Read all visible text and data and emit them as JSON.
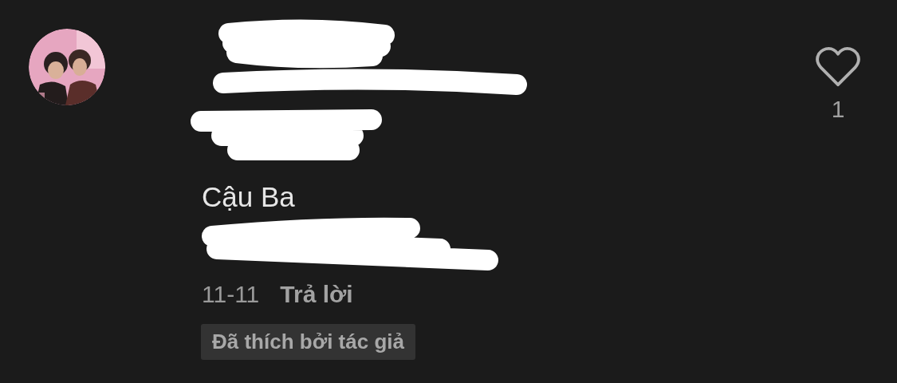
{
  "comment": {
    "lines": [
      {
        "kind": "redaction"
      },
      {
        "kind": "redaction"
      },
      {
        "kind": "redaction"
      },
      {
        "kind": "text",
        "text": "Cậu Ba"
      },
      {
        "kind": "redaction"
      }
    ],
    "date": "11-11",
    "reply": "Trả lời",
    "badge": "Đã thích bởi tác giả",
    "like": {
      "liked": false,
      "count": "1"
    }
  }
}
